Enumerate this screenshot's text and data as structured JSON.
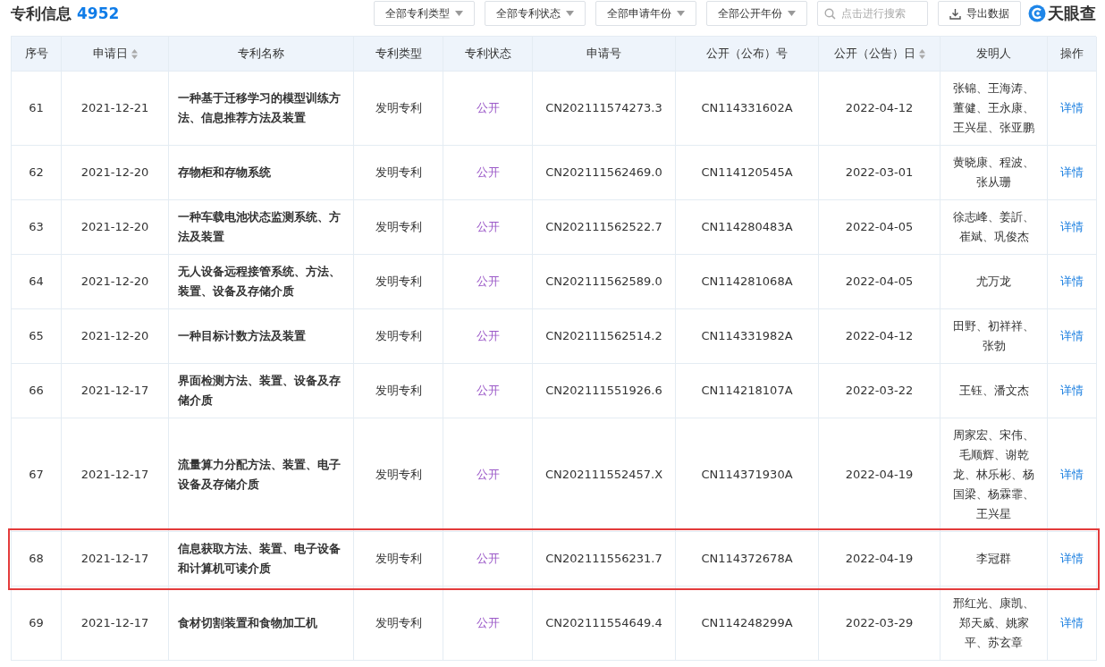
{
  "header": {
    "title": "专利信息",
    "count": "4952"
  },
  "filters": [
    {
      "label": "全部专利类型"
    },
    {
      "label": "全部专利状态"
    },
    {
      "label": "全部申请年份"
    },
    {
      "label": "全部公开年份"
    }
  ],
  "search": {
    "placeholder": "点击进行搜索"
  },
  "export_button": {
    "label": "导出数据"
  },
  "logo": {
    "text": "天眼查"
  },
  "table": {
    "columns": [
      {
        "label": "序号",
        "sortable": false,
        "kind": "text"
      },
      {
        "label": "申请日",
        "sortable": true,
        "kind": "text"
      },
      {
        "label": "专利名称",
        "sortable": false,
        "kind": "title"
      },
      {
        "label": "专利类型",
        "sortable": false,
        "kind": "text"
      },
      {
        "label": "专利状态",
        "sortable": false,
        "kind": "status"
      },
      {
        "label": "申请号",
        "sortable": false,
        "kind": "text"
      },
      {
        "label": "公开（公布）号",
        "sortable": false,
        "kind": "text"
      },
      {
        "label": "公开（公告）日",
        "sortable": true,
        "kind": "text"
      },
      {
        "label": "发明人",
        "sortable": false,
        "kind": "text"
      },
      {
        "label": "操作",
        "sortable": false,
        "kind": "link"
      }
    ],
    "rows": [
      {
        "highlighted": false,
        "cells": [
          "61",
          "2021-12-21",
          "一种基于迁移学习的模型训练方法、信息推荐方法及装置",
          "发明专利",
          "公开",
          "CN202111574273.3",
          "CN114331602A",
          "2022-04-12",
          "张锦、王海涛、董健、王永康、王兴星、张亚鹏",
          "详情"
        ]
      },
      {
        "highlighted": false,
        "cells": [
          "62",
          "2021-12-20",
          "存物柜和存物系统",
          "发明专利",
          "公开",
          "CN202111562469.0",
          "CN114120545A",
          "2022-03-01",
          "黄晓康、程波、张从珊",
          "详情"
        ]
      },
      {
        "highlighted": false,
        "cells": [
          "63",
          "2021-12-20",
          "一种车载电池状态监测系统、方法及装置",
          "发明专利",
          "公开",
          "CN202111562522.7",
          "CN114280483A",
          "2022-04-05",
          "徐志峰、姜訢、崔斌、巩俊杰",
          "详情"
        ]
      },
      {
        "highlighted": false,
        "cells": [
          "64",
          "2021-12-20",
          "无人设备远程接管系统、方法、装置、设备及存储介质",
          "发明专利",
          "公开",
          "CN202111562589.0",
          "CN114281068A",
          "2022-04-05",
          "尤万龙",
          "详情"
        ]
      },
      {
        "highlighted": false,
        "cells": [
          "65",
          "2021-12-20",
          "一种目标计数方法及装置",
          "发明专利",
          "公开",
          "CN202111562514.2",
          "CN114331982A",
          "2022-04-12",
          "田野、初祥祥、张勃",
          "详情"
        ]
      },
      {
        "highlighted": false,
        "cells": [
          "66",
          "2021-12-17",
          "界面检测方法、装置、设备及存储介质",
          "发明专利",
          "公开",
          "CN202111551926.6",
          "CN114218107A",
          "2022-03-22",
          "王钰、潘文杰",
          "详情"
        ]
      },
      {
        "highlighted": false,
        "cells": [
          "67",
          "2021-12-17",
          "流量算力分配方法、装置、电子设备及存储介质",
          "发明专利",
          "公开",
          "CN202111552457.X",
          "CN114371930A",
          "2022-04-19",
          "周家宏、宋伟、毛顺辉、谢乾龙、林乐彬、杨国梁、杨霖霏、王兴星",
          "详情"
        ]
      },
      {
        "highlighted": true,
        "cells": [
          "68",
          "2021-12-17",
          "信息获取方法、装置、电子设备和计算机可读介质",
          "发明专利",
          "公开",
          "CN202111556231.7",
          "CN114372678A",
          "2022-04-19",
          "李冠群",
          "详情"
        ]
      },
      {
        "highlighted": false,
        "cells": [
          "69",
          "2021-12-17",
          "食材切割装置和食物加工机",
          "发明专利",
          "公开",
          "CN202111554649.4",
          "CN114248299A",
          "2022-03-29",
          "邢红光、康凯、郑天威、姚家平、苏玄章",
          "详情"
        ]
      }
    ]
  }
}
